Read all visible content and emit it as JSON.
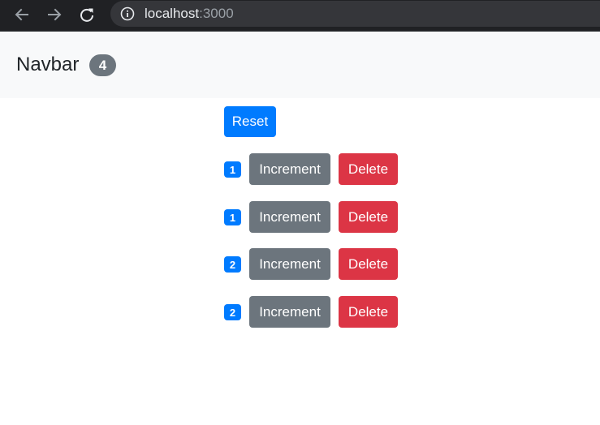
{
  "browser": {
    "back_icon": "arrow-left-icon",
    "forward_icon": "arrow-right-icon",
    "reload_icon": "reload-icon",
    "info_icon": "info-icon",
    "url_host": "localhost",
    "url_port": ":3000"
  },
  "navbar": {
    "brand": "Navbar",
    "total_count": "4"
  },
  "main": {
    "reset_label": "Reset",
    "counters": [
      {
        "value": "1",
        "increment_label": "Increment",
        "delete_label": "Delete"
      },
      {
        "value": "1",
        "increment_label": "Increment",
        "delete_label": "Delete"
      },
      {
        "value": "2",
        "increment_label": "Increment",
        "delete_label": "Delete"
      },
      {
        "value": "2",
        "increment_label": "Increment",
        "delete_label": "Delete"
      }
    ]
  },
  "colors": {
    "primary": "#007bff",
    "secondary": "#6c757d",
    "danger": "#dc3545",
    "navbar_bg": "#f8f9fa"
  }
}
